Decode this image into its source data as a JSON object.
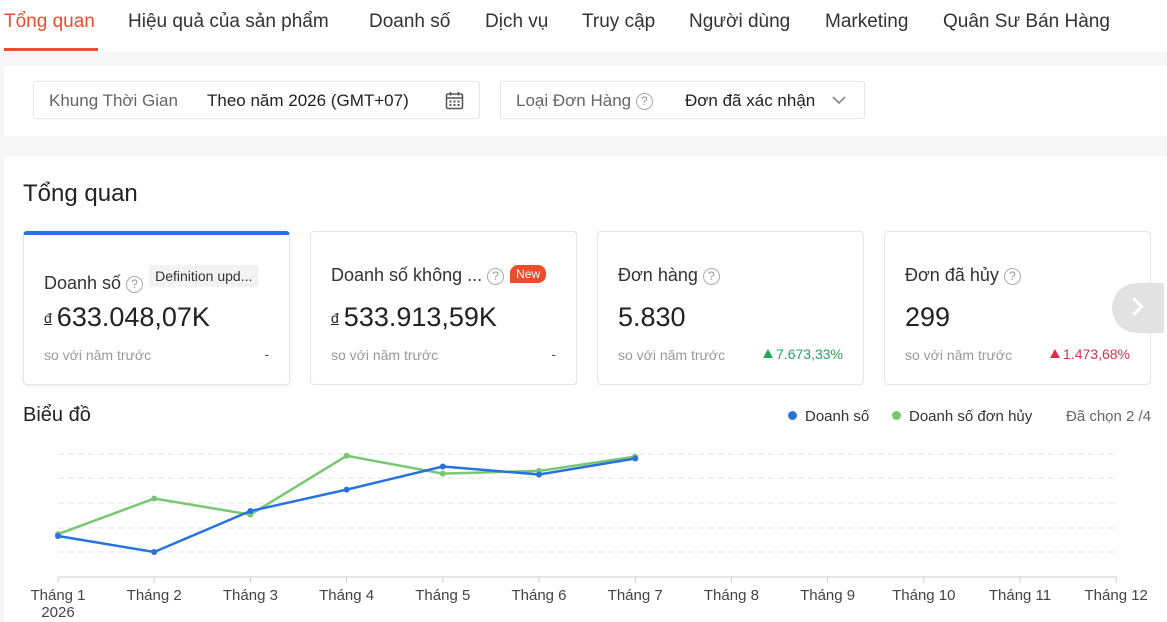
{
  "tabs": [
    {
      "label": "Tổng quan",
      "active": true
    },
    {
      "label": "Hiệu quả của sản phẩm"
    },
    {
      "label": "Doanh số"
    },
    {
      "label": "Dịch vụ"
    },
    {
      "label": "Truy cập"
    },
    {
      "label": "Người dùng"
    },
    {
      "label": "Marketing"
    },
    {
      "label": "Quân Sư Bán Hàng"
    }
  ],
  "filters": {
    "time_label": "Khung Thời Gian",
    "time_value": "Theo năm  2026 (GMT+07)",
    "order_label": "Loại Đơn Hàng",
    "order_value": "Đơn đã xác nhận"
  },
  "overview": {
    "title": "Tổng quan",
    "help_glyph": "?",
    "kpis": [
      {
        "title": "Doanh số",
        "badge": "Definition upd...",
        "currency": "đ",
        "value": "633.048,07K",
        "compare": "so với năm trước",
        "change": "-",
        "trend": "flat"
      },
      {
        "title": "Doanh số không ...",
        "badge_new": "New",
        "currency": "đ",
        "value": "533.913,59K",
        "compare": "so với năm trước",
        "change": "-",
        "trend": "flat"
      },
      {
        "title": "Đơn hàng",
        "value": "5.830",
        "compare": "so với năm trước",
        "change": "7.673,33%",
        "trend": "up"
      },
      {
        "title": "Đơn đã hủy",
        "value": "299",
        "compare": "so với năm trước",
        "change": "1.473,68%",
        "trend": "down"
      }
    ]
  },
  "chart_section": {
    "title": "Biểu đồ",
    "legend": [
      {
        "name": "Doanh số",
        "color": "#2673dd"
      },
      {
        "name": "Doanh số đơn hủy",
        "color": "#7ac773"
      }
    ],
    "selected": "Đã chọn 2 /4"
  },
  "chart_data": {
    "type": "line",
    "categories": [
      "Tháng 1",
      "Tháng 2",
      "Tháng 3",
      "Tháng 4",
      "Tháng 5",
      "Tháng 6",
      "Tháng 7",
      "Tháng 8",
      "Tháng 9",
      "Tháng 10",
      "Tháng 11",
      "Tháng 12"
    ],
    "first_category_sublabel": "2026",
    "grid": true,
    "series": [
      {
        "name": "Doanh số",
        "color": "#2673dd",
        "values": [
          0.18,
          0.0,
          0.46,
          0.7,
          0.96,
          0.87,
          1.05
        ]
      },
      {
        "name": "Doanh số đơn hủy",
        "color": "#7ac773",
        "values": [
          0.2,
          0.6,
          0.42,
          1.08,
          0.88,
          0.91,
          1.07
        ]
      }
    ],
    "ylim": [
      0,
      1.1
    ]
  }
}
